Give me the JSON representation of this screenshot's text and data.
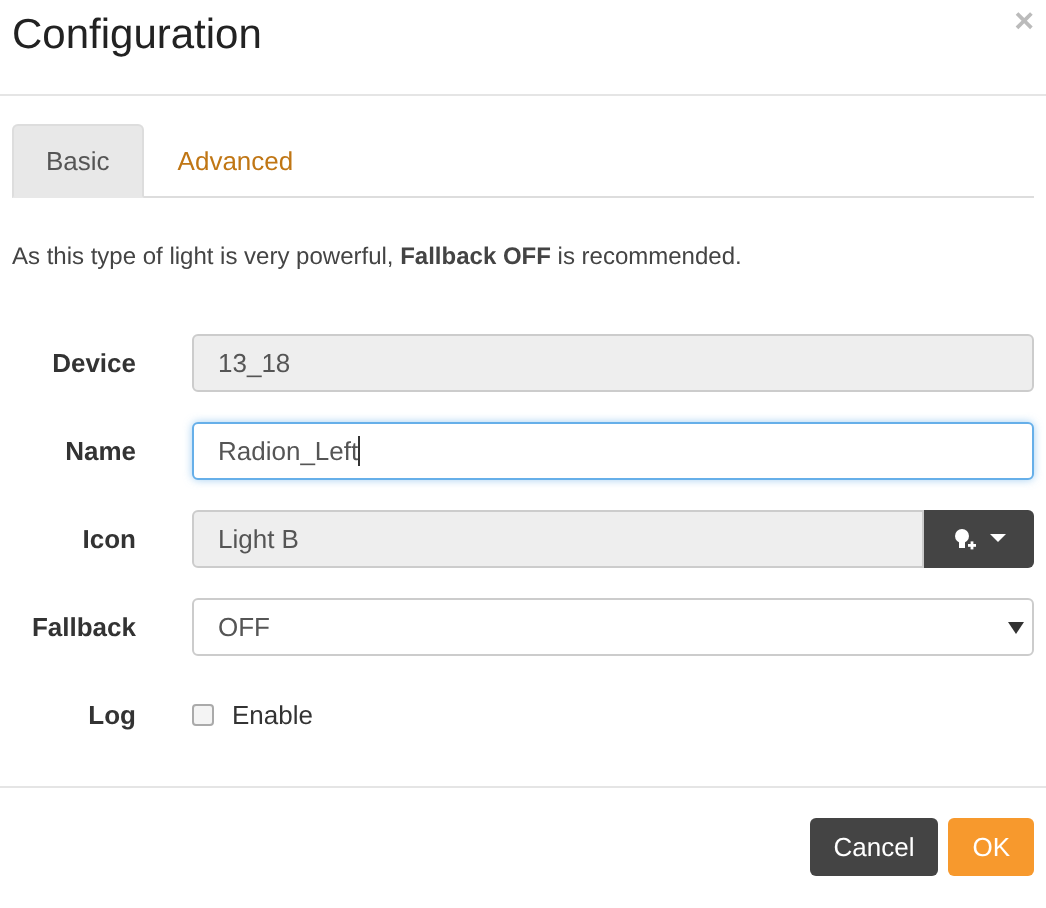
{
  "dialog": {
    "title": "Configuration",
    "close": "×"
  },
  "tabs": [
    {
      "label": "Basic",
      "selected": true
    },
    {
      "label": "Advanced",
      "selected": false
    }
  ],
  "message": "As this type of light is very powerful, **Fallback OFF** is recommended.",
  "fields": [
    {
      "kind": "readonly",
      "label": "Device",
      "value": "13_18"
    },
    {
      "kind": "input",
      "label": "Name",
      "value": "Radion_Left",
      "focused": true
    },
    {
      "kind": "icon-select",
      "label": "Icon",
      "value": "Light B"
    },
    {
      "kind": "select",
      "label": "Fallback",
      "value": "OFF"
    },
    {
      "kind": "checkbox",
      "label": "Log",
      "text": "Enable",
      "checked": false
    }
  ],
  "buttons": [
    {
      "label": "Cancel",
      "kind": "default"
    },
    {
      "label": "OK",
      "kind": "primary"
    }
  ]
}
